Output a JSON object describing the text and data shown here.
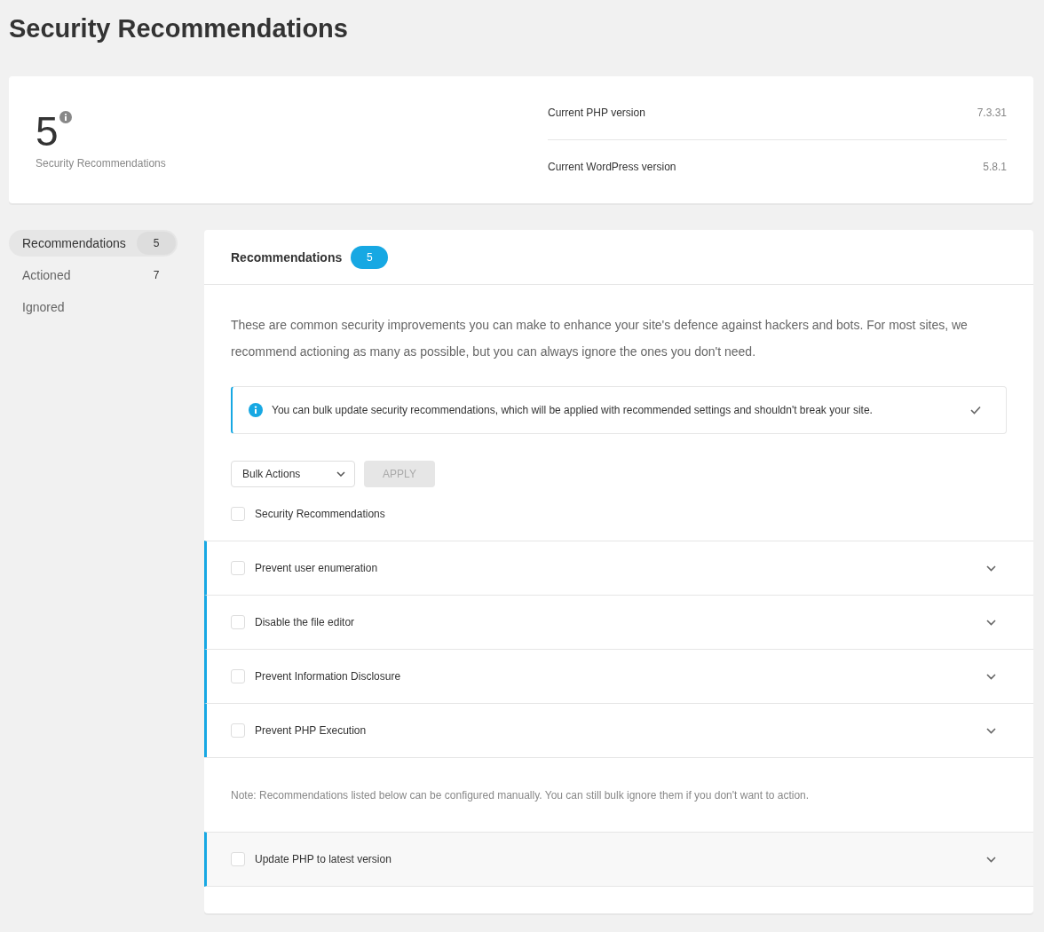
{
  "page_title": "Security Recommendations",
  "summary": {
    "count": "5",
    "count_label": "Security Recommendations",
    "versions": [
      {
        "label": "Current PHP version",
        "value": "7.3.31"
      },
      {
        "label": "Current WordPress version",
        "value": "5.8.1"
      }
    ]
  },
  "sidebar": {
    "items": [
      {
        "label": "Recommendations",
        "count": "5",
        "selected": true
      },
      {
        "label": "Actioned",
        "count": "7",
        "selected": false
      },
      {
        "label": "Ignored",
        "selected": false
      }
    ]
  },
  "panel": {
    "title": "Recommendations",
    "badge": "5",
    "description": "These are common security improvements you can make to enhance your site's defence against hackers and bots. For most sites, we recommend actioning as many as possible, but you can always ignore the ones you don't need.",
    "notice": "You can bulk update security recommendations, which will be applied with recommended settings and shouldn't break your site.",
    "bulk_select": "Bulk Actions",
    "apply_button": {
      "label": "APPLY",
      "disabled": true
    },
    "select_all": {
      "label": "Security Recommendations",
      "checked": false
    },
    "items": [
      {
        "label": "Prevent user enumeration",
        "checked": false
      },
      {
        "label": "Disable the file editor",
        "checked": false
      },
      {
        "label": "Prevent Information Disclosure",
        "checked": false
      },
      {
        "label": "Prevent PHP Execution",
        "checked": false
      }
    ],
    "note": "Note: Recommendations listed below can be configured manually. You can still bulk ignore them if you don't want to action.",
    "manual_items": [
      {
        "label": "Update PHP to latest version",
        "checked": false
      }
    ]
  }
}
